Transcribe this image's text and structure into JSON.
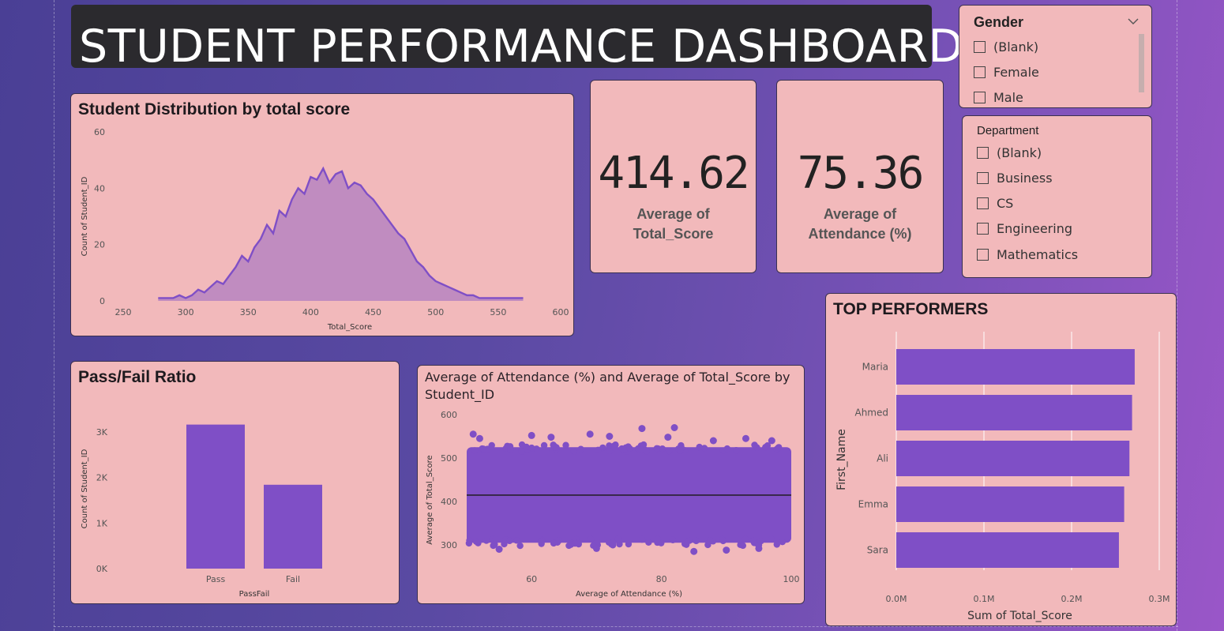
{
  "dashboard_title": "STUDENT PERFORMANCE DASHBOARD",
  "colors": {
    "accent": "#7f4fc6",
    "card_bg": "#f2b9bb",
    "title_bg": "#2b2a2e"
  },
  "kpis": [
    {
      "value": "414.62",
      "label_line1": "Average of",
      "label_line2": "Total_Score"
    },
    {
      "value": "75.36",
      "label_line1": "Average of",
      "label_line2": "Attendance (%)"
    }
  ],
  "slicers": {
    "gender": {
      "title": "Gender",
      "items": [
        "(Blank)",
        "Female",
        "Male"
      ]
    },
    "department": {
      "title": "Department",
      "items": [
        "(Blank)",
        "Business",
        "CS",
        "Engineering",
        "Mathematics"
      ]
    }
  },
  "chart_data": [
    {
      "id": "distribution",
      "type": "area",
      "title": "Student Distribution by total score",
      "xlabel": "Total_Score",
      "ylabel": "Count of Student_ID",
      "xlim": [
        250,
        600
      ],
      "ylim": [
        0,
        60
      ],
      "x_ticks": [
        "250",
        "300",
        "350",
        "400",
        "450",
        "500",
        "550",
        "600"
      ],
      "y_ticks": [
        "0",
        "20",
        "40",
        "60"
      ],
      "x": [
        278,
        285,
        290,
        295,
        300,
        305,
        310,
        315,
        320,
        325,
        330,
        335,
        340,
        345,
        350,
        355,
        360,
        365,
        370,
        375,
        380,
        385,
        390,
        395,
        400,
        405,
        410,
        415,
        420,
        425,
        430,
        435,
        440,
        445,
        450,
        455,
        460,
        465,
        470,
        475,
        480,
        485,
        490,
        495,
        500,
        505,
        510,
        515,
        520,
        525,
        530,
        535,
        540,
        545,
        550,
        560,
        570
      ],
      "values": [
        1,
        1,
        1,
        2,
        1,
        2,
        4,
        3,
        5,
        7,
        6,
        9,
        12,
        16,
        14,
        19,
        22,
        27,
        24,
        32,
        30,
        36,
        40,
        38,
        44,
        43,
        47,
        42,
        45,
        46,
        40,
        42,
        41,
        38,
        36,
        33,
        30,
        27,
        24,
        22,
        18,
        14,
        12,
        9,
        7,
        6,
        5,
        4,
        3,
        2,
        2,
        1,
        1,
        1,
        1,
        1,
        1
      ]
    },
    {
      "id": "pass_fail",
      "type": "bar",
      "title": "Pass/Fail Ratio",
      "xlabel": "PassFail",
      "ylabel": "Count of Student_ID",
      "categories": [
        "Pass",
        "Fail"
      ],
      "values": [
        3160,
        1840
      ],
      "ylim": [
        0,
        3500
      ],
      "y_ticks": [
        "0K",
        "1K",
        "2K",
        "3K"
      ]
    },
    {
      "id": "scatter",
      "type": "scatter",
      "title": "Average of Attendance (%) and Average of Total_Score by Student_ID",
      "xlabel": "Average of Attendance (%)",
      "ylabel": "Average of Total_Score",
      "xlim": [
        50,
        100
      ],
      "ylim": [
        280,
        600
      ],
      "x_ticks": [
        "60",
        "80",
        "100"
      ],
      "y_ticks": [
        "300",
        "400",
        "500",
        "600"
      ],
      "trend_y": 414.62,
      "outliers": [
        [
          51,
          555
        ],
        [
          52,
          545
        ],
        [
          60,
          552
        ],
        [
          63,
          548
        ],
        [
          69,
          555
        ],
        [
          72,
          550
        ],
        [
          77,
          568
        ],
        [
          81,
          548
        ],
        [
          82,
          570
        ],
        [
          88,
          540
        ],
        [
          93,
          545
        ],
        [
          97,
          540
        ],
        [
          55,
          290
        ],
        [
          70,
          292
        ],
        [
          85,
          285
        ],
        [
          90,
          288
        ],
        [
          95,
          292
        ]
      ],
      "band": {
        "x_range": [
          50,
          100
        ],
        "y_range": [
          305,
          525
        ]
      }
    },
    {
      "id": "top_performers",
      "type": "bar",
      "orientation": "horizontal",
      "title": "TOP PERFORMERS",
      "xlabel": "Sum of Total_Score",
      "ylabel": "First_Name",
      "categories": [
        "Maria",
        "Ahmed",
        "Ali",
        "Emma",
        "Sara"
      ],
      "values": [
        272000,
        269000,
        266000,
        260000,
        254000
      ],
      "xlim": [
        0,
        300000
      ],
      "x_ticks": [
        "0.0M",
        "0.1M",
        "0.2M",
        "0.3M"
      ]
    }
  ]
}
